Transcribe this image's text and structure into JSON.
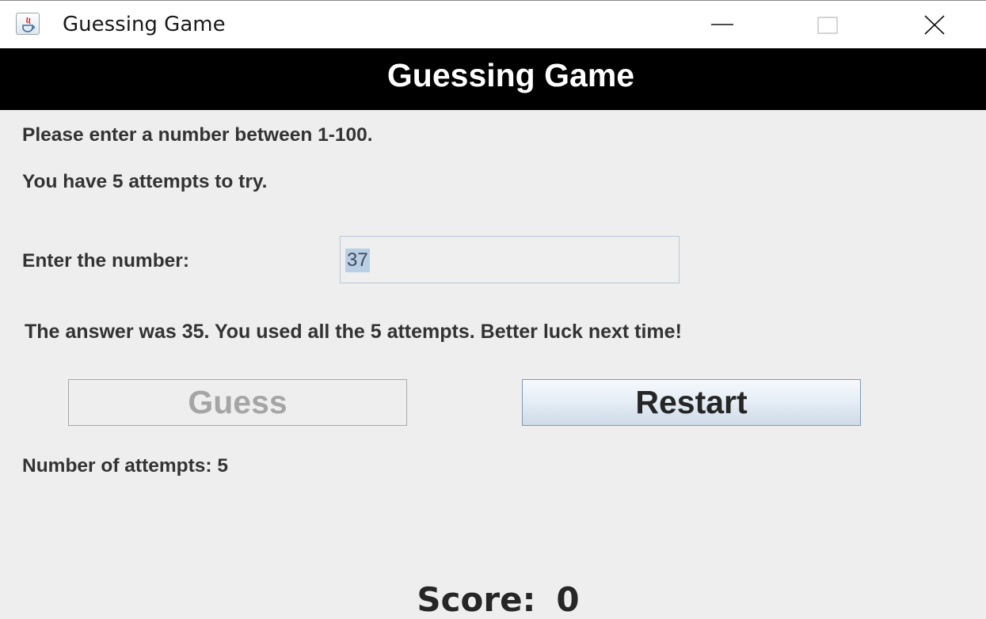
{
  "window": {
    "title": "Guessing Game",
    "icon": "java-icon",
    "controls": [
      "minimize-icon",
      "maximize-icon",
      "close-icon"
    ]
  },
  "header": {
    "title": "Guessing Game"
  },
  "instructions": {
    "range": "Please enter a number between 1-100.",
    "attempts": "You have 5 attempts to try."
  },
  "input": {
    "label": "Enter the number:",
    "value": "37"
  },
  "result": {
    "message": "The answer was 35. You used all the 5 attempts. Better luck next time!"
  },
  "buttons": {
    "guess_label": "Guess",
    "guess_enabled": false,
    "restart_label": "Restart"
  },
  "status": {
    "attempts_text": "Number of attempts: 5"
  },
  "score": {
    "label": "Score:",
    "value": "0"
  }
}
